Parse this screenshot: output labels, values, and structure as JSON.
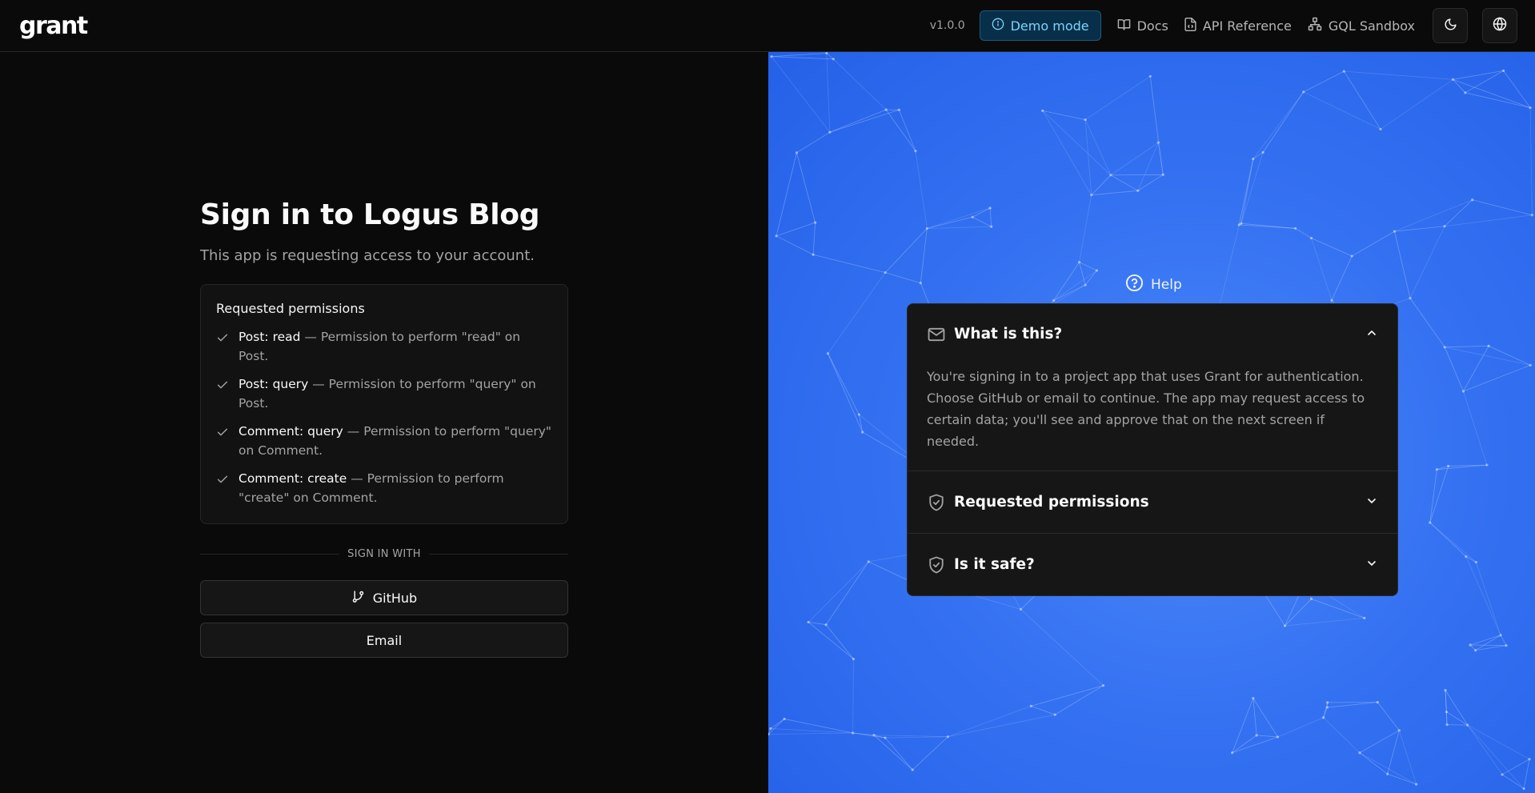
{
  "header": {
    "logo": "grant",
    "version": "v1.0.0",
    "demo_mode": "Demo mode",
    "links": [
      {
        "label": "Docs",
        "icon": "book-icon"
      },
      {
        "label": "API Reference",
        "icon": "file-code-icon"
      },
      {
        "label": "GQL Sandbox",
        "icon": "network-icon"
      }
    ],
    "theme_toggle_icon": "moon-icon",
    "language_icon": "globe-icon"
  },
  "signin": {
    "title": "Sign in to Logus Blog",
    "subtitle": "This app is requesting access to your account.",
    "permissions_title": "Requested permissions",
    "permissions": [
      {
        "name": "Post: read",
        "desc": " — Permission to perform \"read\" on Post."
      },
      {
        "name": "Post: query",
        "desc": " — Permission to perform \"query\" on Post."
      },
      {
        "name": "Comment: query",
        "desc": " — Permission to perform \"query\" on Comment."
      },
      {
        "name": "Comment: create",
        "desc": " — Permission to perform \"create\" on Comment."
      }
    ],
    "divider": "SIGN IN WITH",
    "github_label": "GitHub",
    "email_label": "Email"
  },
  "help": {
    "label": "Help",
    "items": [
      {
        "title": "What is this?",
        "icon": "mail-icon",
        "open": true,
        "body": "You're signing in to a project app that uses Grant for authentication. Choose GitHub or email to continue. The app may request access to certain data; you'll see and approve that on the next screen if needed."
      },
      {
        "title": "Requested permissions",
        "icon": "shield-check-icon",
        "open": false
      },
      {
        "title": "Is it safe?",
        "icon": "shield-check-icon",
        "open": false
      }
    ]
  },
  "colors": {
    "background": "#0a0a0a",
    "accent_blue": "#3572f2",
    "demo_text": "#7dd3fc",
    "card": "#121212"
  }
}
